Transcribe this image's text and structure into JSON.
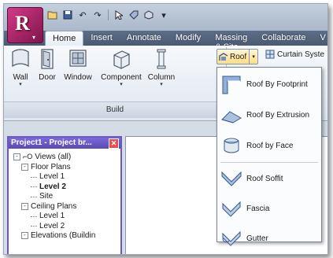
{
  "qat": {
    "icons": [
      "open-icon",
      "save-icon",
      "undo-icon",
      "redo-icon",
      "select-icon",
      "tag-icon",
      "3d-icon",
      "dropdown-icon"
    ]
  },
  "tabs": [
    "Home",
    "Insert",
    "Annotate",
    "Modify",
    "Massing & Site",
    "Collaborate",
    "V"
  ],
  "ribbon": {
    "buttons": [
      {
        "label": "Wall",
        "dropdown": true
      },
      {
        "label": "Door",
        "dropdown": false
      },
      {
        "label": "Window",
        "dropdown": false
      },
      {
        "label": "Component",
        "dropdown": true
      },
      {
        "label": "Column",
        "dropdown": true
      }
    ],
    "panel_label": "Build",
    "roof_label": "Roof",
    "curtain_label": "Curtain Syste"
  },
  "roof_menu": {
    "items": [
      "Roof By Footprint",
      "Roof By Extrusion",
      "Roof by Face",
      "Roof Soffit",
      "Fascia",
      "Gutter"
    ]
  },
  "browser": {
    "title": "Project1 - Project br...",
    "tree": [
      {
        "label": "Views (all)",
        "level": 0,
        "toggle": "-",
        "bold": false
      },
      {
        "label": "Floor Plans",
        "level": 1,
        "toggle": "-",
        "bold": false
      },
      {
        "label": "Level 1",
        "level": 2,
        "toggle": "",
        "bold": false
      },
      {
        "label": "Level 2",
        "level": 2,
        "toggle": "",
        "bold": true
      },
      {
        "label": "Site",
        "level": 2,
        "toggle": "",
        "bold": false
      },
      {
        "label": "Ceiling Plans",
        "level": 1,
        "toggle": "-",
        "bold": false
      },
      {
        "label": "Level 1",
        "level": 2,
        "toggle": "",
        "bold": false
      },
      {
        "label": "Level 2",
        "level": 2,
        "toggle": "",
        "bold": false
      },
      {
        "label": "Elevations (Buildin",
        "level": 1,
        "toggle": "-",
        "bold": false
      }
    ]
  },
  "colors": {
    "accent": "#6a59c4",
    "app_button": "#b0236a",
    "menu_highlight": "#ffdc83"
  }
}
